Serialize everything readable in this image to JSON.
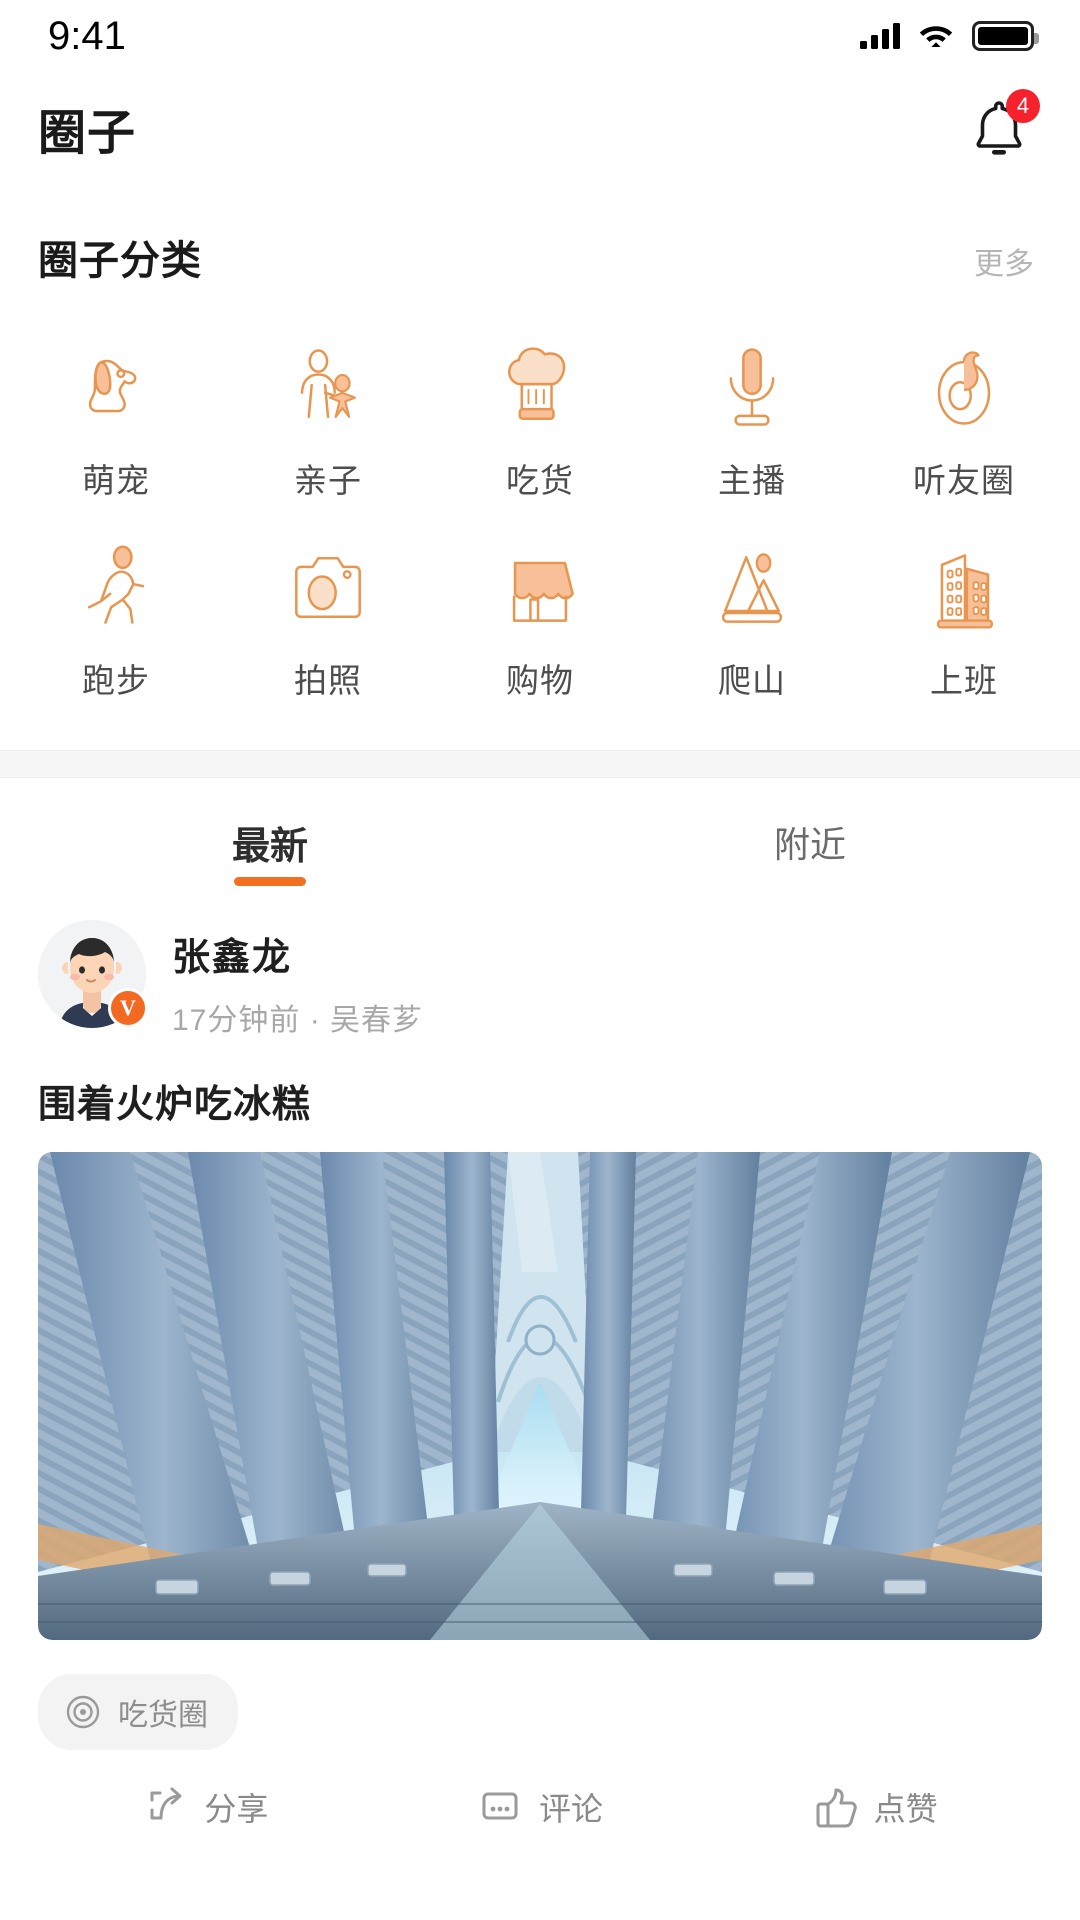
{
  "status_bar": {
    "time": "9:41",
    "icons": [
      "cellular-signal-icon",
      "wifi-icon",
      "battery-icon"
    ]
  },
  "header": {
    "title": "圈子",
    "bell_icon": "bell-icon",
    "notification_count": "4"
  },
  "categories_section": {
    "title": "圈子分类",
    "more_label": "更多",
    "items": [
      {
        "label": "萌宠",
        "icon": "dog-icon"
      },
      {
        "label": "亲子",
        "icon": "parent-child-icon"
      },
      {
        "label": "吃货",
        "icon": "chef-hat-icon"
      },
      {
        "label": "主播",
        "icon": "microphone-icon"
      },
      {
        "label": "听友圈",
        "icon": "headphone-loop-icon"
      },
      {
        "label": "跑步",
        "icon": "running-person-icon"
      },
      {
        "label": "拍照",
        "icon": "camera-icon"
      },
      {
        "label": "购物",
        "icon": "shop-awning-icon"
      },
      {
        "label": "爬山",
        "icon": "mountain-icon"
      },
      {
        "label": "上班",
        "icon": "office-building-icon"
      }
    ]
  },
  "feed_tabs": {
    "active_index": 0,
    "tabs": [
      {
        "label": "最新"
      },
      {
        "label": "附近"
      }
    ]
  },
  "post": {
    "author": "张鑫龙",
    "verified_mark": "V",
    "meta": "17分钟前 · 吴春芗",
    "title": "围着火炉吃冰糕",
    "image_alt": "blue-architectural-corridor-photo",
    "tag": {
      "icon": "circle-target-icon",
      "label": "吃货圈"
    },
    "actions": [
      {
        "label": "分享",
        "icon": "share-icon"
      },
      {
        "label": "评论",
        "icon": "comment-icon"
      },
      {
        "label": "点赞",
        "icon": "thumbs-up-icon"
      }
    ]
  },
  "colors": {
    "accent_orange": "#f37021",
    "icon_orange": "#f0a06a",
    "icon_orange_fill": "#f9c9a4",
    "badge_red": "#f5222d",
    "text_primary": "#1f1f1f",
    "text_secondary": "#8a8a8a",
    "divider_gray": "#f7f7f7"
  }
}
